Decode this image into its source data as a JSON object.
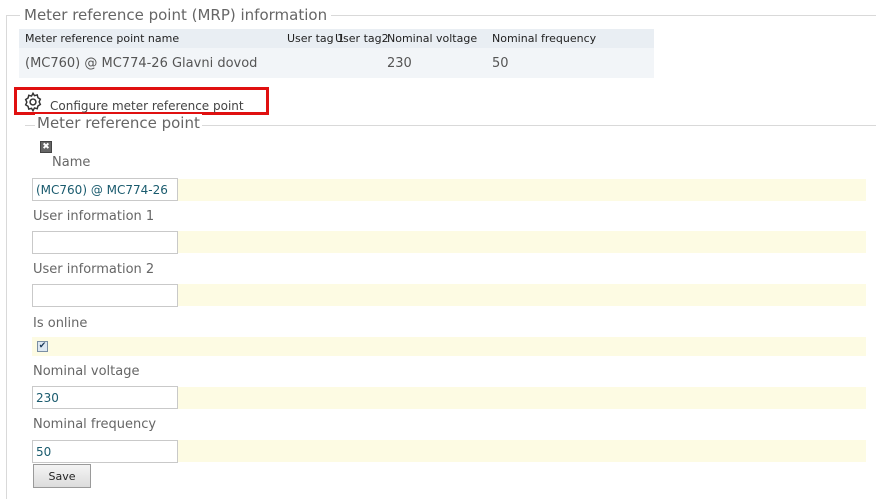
{
  "mrp_section": {
    "legend": "Meter reference point (MRP) information",
    "table": {
      "headers": [
        "Meter reference point name",
        "User tag 1",
        "User tag2",
        "Nominal voltage",
        "Nominal frequency"
      ],
      "row": [
        "(MC760) @ MC774-26 Glavni dovod",
        "",
        "",
        "230",
        "50"
      ]
    }
  },
  "configure_link": {
    "label": "Configure meter reference point",
    "icon": "gear-icon",
    "highlight_color": "#e01010"
  },
  "form": {
    "legend": "Meter reference point",
    "name": {
      "label": "Name",
      "value": "(MC760) @ MC774-26"
    },
    "user_info_1": {
      "label": "User information 1",
      "value": ""
    },
    "user_info_2": {
      "label": "User information 2",
      "value": ""
    },
    "is_online": {
      "label": "Is online",
      "checked": true
    },
    "nominal_voltage": {
      "label": "Nominal voltage",
      "value": "230"
    },
    "nominal_frequency": {
      "label": "Nominal frequency",
      "value": "50"
    },
    "save_label": "Save"
  },
  "colors": {
    "row_highlight": "#fdfbe3",
    "table_header": "#e9eef3"
  }
}
